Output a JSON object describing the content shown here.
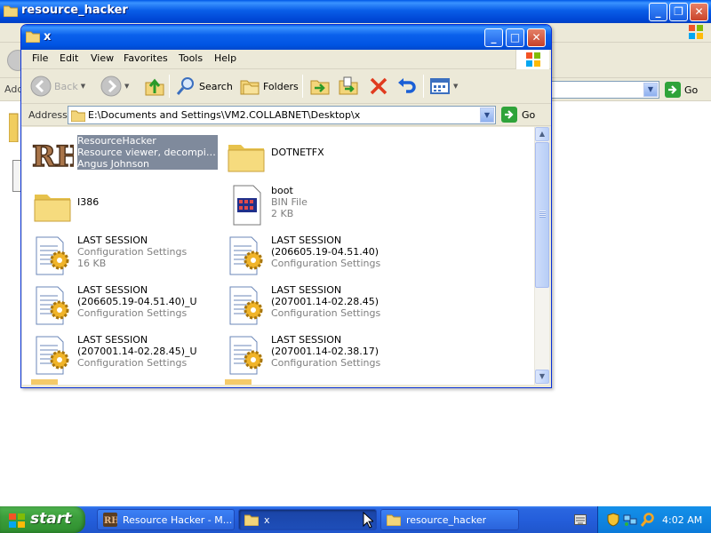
{
  "background_window": {
    "title": "resource_hacker",
    "address_label": "Addr",
    "go_label": "Go"
  },
  "window": {
    "title": "x",
    "menu": [
      "File",
      "Edit",
      "View",
      "Favorites",
      "Tools",
      "Help"
    ],
    "toolbar": {
      "back": "Back",
      "search": "Search",
      "folders": "Folders"
    },
    "address": {
      "label": "Address",
      "path": "E:\\Documents and Settings\\VM2.COLLABNET\\Desktop\\x",
      "go": "Go"
    },
    "items": [
      {
        "name": "ResourceHacker",
        "line2": "Resource viewer, decompiler ...",
        "line3": "Angus Johnson",
        "icon": "resource-hacker-icon",
        "selected": true
      },
      {
        "name": "DOTNETFX",
        "line2": "",
        "line3": "",
        "icon": "folder-icon"
      },
      {
        "name": "I386",
        "line2": "",
        "line3": "",
        "icon": "folder-icon"
      },
      {
        "name": "boot",
        "line2": "BIN File",
        "line3": "2 KB",
        "icon": "bin-file-icon"
      },
      {
        "name": "LAST SESSION",
        "line2": "Configuration Settings",
        "line3": "16 KB",
        "icon": "config-settings-icon"
      },
      {
        "name": "LAST SESSION",
        "line2": "(206605.19-04.51.40)",
        "line3": "Configuration Settings",
        "icon": "config-settings-icon"
      },
      {
        "name": "LAST SESSION",
        "line2": "(206605.19-04.51.40)_U",
        "line3": "Configuration Settings",
        "icon": "config-settings-icon"
      },
      {
        "name": "LAST SESSION",
        "line2": "(207001.14-02.28.45)",
        "line3": "Configuration Settings",
        "icon": "config-settings-icon"
      },
      {
        "name": "LAST SESSION",
        "line2": "(207001.14-02.28.45)_U",
        "line3": "Configuration Settings",
        "icon": "config-settings-icon"
      },
      {
        "name": "LAST SESSION",
        "line2": "(207001.14-02.38.17)",
        "line3": "Configuration Settings",
        "icon": "config-settings-icon"
      }
    ]
  },
  "taskbar": {
    "start": "start",
    "tasks": [
      {
        "label": "Resource Hacker - M...",
        "icon": "resource-hacker-icon",
        "active": false
      },
      {
        "label": "x",
        "icon": "folder-icon",
        "active": true
      },
      {
        "label": "resource_hacker",
        "icon": "folder-icon",
        "active": false
      }
    ],
    "clock": "4:02 AM"
  },
  "colors": {
    "title_blue": "#0054e3",
    "taskbar_blue": "#245edb",
    "start_green": "#3c9e3c",
    "selection": "#7f8a9c"
  }
}
